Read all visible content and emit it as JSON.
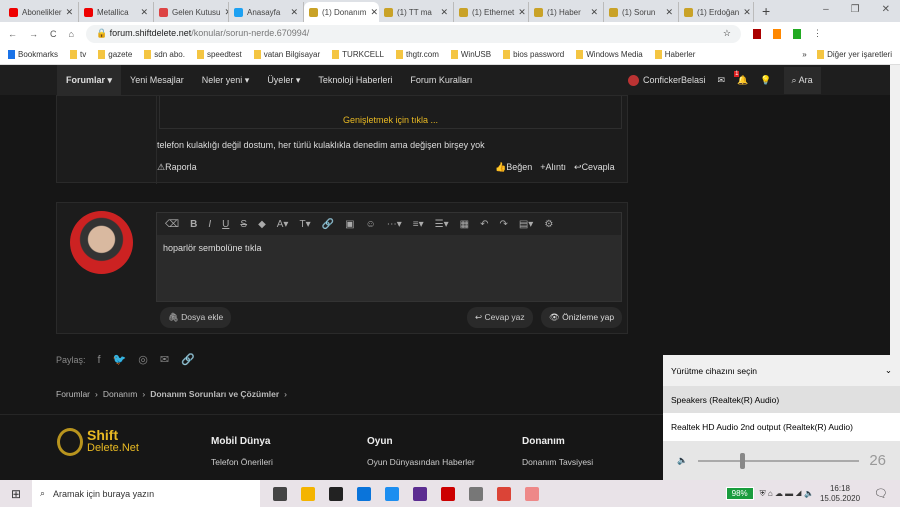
{
  "tabs": [
    {
      "label": "Abonelikler",
      "color": "#e00"
    },
    {
      "label": "Metallica",
      "color": "#e00"
    },
    {
      "label": "Gelen Kutusu",
      "color": "#d44"
    },
    {
      "label": "Anasayfa",
      "color": "#1da1f2"
    },
    {
      "label": "(1) Donanım",
      "color": "#c9a227",
      "active": true
    },
    {
      "label": "(1) TT ma",
      "color": "#c9a227"
    },
    {
      "label": "(1) Ethernet",
      "color": "#c9a227"
    },
    {
      "label": "(1) Haber",
      "color": "#c9a227"
    },
    {
      "label": "(1) Sorun",
      "color": "#c9a227"
    },
    {
      "label": "(1) Erdoğan",
      "color": "#c9a227"
    }
  ],
  "url_domain": "forum.shiftdelete.net",
  "url_path": "/konular/sorun-nerde.670994/",
  "bookmarks": [
    "Bookmarks",
    "tv",
    "gazete",
    "sdn abo.",
    "speedtest",
    "vatan Bilgisayar",
    "TURKCELL",
    "thgtr.com",
    "WinUSB",
    "bios password",
    "Windows Media",
    "Haberler"
  ],
  "bookmarks_other": "Diğer yer işaretleri",
  "nav": {
    "items": [
      "Forumlar",
      "Yeni Mesajlar",
      "Neler yeni",
      "Üyeler",
      "Teknoloji Haberleri",
      "Forum Kuralları"
    ],
    "user": "ConfickerBelasi",
    "notif_count": "1",
    "search": "Ara"
  },
  "post": {
    "expand": "Genişletmek için tıkla ...",
    "text": "telefon kulaklığı değil dostum, her türlü kulaklıkla denedim ama değişen birşey yok",
    "report": "Raporla",
    "like": "Beğen",
    "quote": "+Alıntı",
    "reply": "Cevapla"
  },
  "editor": {
    "text": "hoparlör sembolüne tıkla",
    "attach": "Dosya ekle",
    "submit": "Cevap yaz",
    "preview": "Önizleme yap"
  },
  "share_label": "Paylaş:",
  "breadcrumb": [
    "Forumlar",
    "Donanım",
    "Donanım Sorunları ve Çözümler"
  ],
  "footer": {
    "logo_top": "Shift",
    "logo_bottom": "Delete.Net",
    "cols": [
      {
        "title": "Mobil Dünya",
        "link": "Telefon Önerileri"
      },
      {
        "title": "Oyun",
        "link": "Oyun Dünyasından Haberler"
      },
      {
        "title": "Donanım",
        "link": "Donanım Tavsiyesi"
      }
    ]
  },
  "flyout": {
    "title": "Yürütme cihazını seçin",
    "devices": [
      "Speakers (Realtek(R) Audio)",
      "Realtek HD Audio 2nd output (Realtek(R) Audio)"
    ],
    "volume": "26",
    "volume_fraction": 0.26
  },
  "taskbar": {
    "search": "Aramak için buraya yazın",
    "battery": "98%",
    "time": "16:18",
    "date": "15.05.2020"
  }
}
